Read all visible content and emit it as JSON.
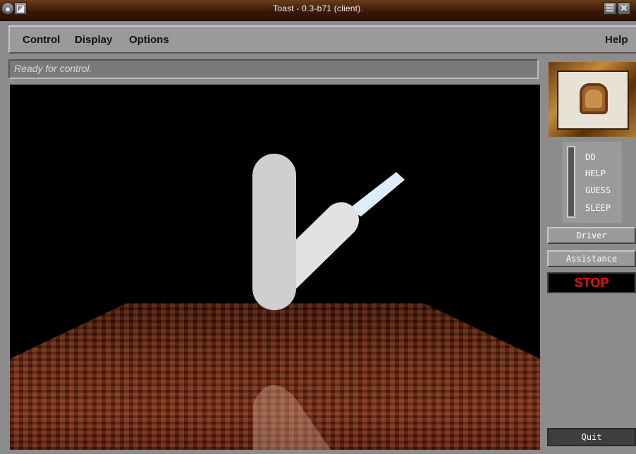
{
  "window": {
    "title": "Toast - 0.3-b71 (client).",
    "icons": [
      "app-icon",
      "minimize-icon",
      "maximize-icon",
      "close-icon"
    ]
  },
  "menu": {
    "items": [
      "Control",
      "Display",
      "Options"
    ],
    "help": "Help"
  },
  "status": "Ready for control.",
  "commands": [
    "DO",
    "HELP",
    "GUESS",
    "SLEEP"
  ],
  "panel": {
    "driver": "Driver",
    "assistance": "Assistance",
    "stop": "STOP",
    "quit": "Quit"
  },
  "colors": {
    "stop_text": "#e81010",
    "title_bar": "#3a1a08",
    "floor": "#6a2a14"
  }
}
